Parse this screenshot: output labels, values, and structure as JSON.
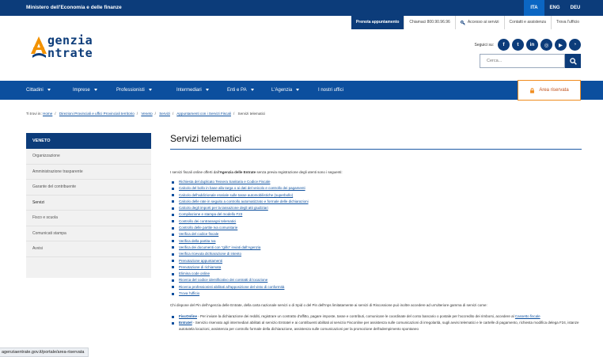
{
  "topbar": {
    "ministry": "Ministero dell'Economia e delle finanze",
    "languages": [
      "ITA",
      "ENG",
      "DEU"
    ],
    "active_language": "ITA"
  },
  "header": {
    "appointment_label": "Prenota appuntamento",
    "phone_label": "Chiamaci 800.90.96.96",
    "services_access_label": "Accesso ai servizi",
    "contacts_label": "Contatti e assistenza",
    "office_label": "Trova l'ufficio",
    "logo_line1": "genzia",
    "logo_line2": "ntrate",
    "social_label": "Seguici su:",
    "search_placeholder": "Cerca..."
  },
  "nav": {
    "items": [
      "Cittadini",
      "Imprese",
      "Professionisti",
      "Intermediari",
      "Enti e PA",
      "L'Agenzia",
      "I nostri uffici"
    ],
    "reserved_label": "Area riservata"
  },
  "breadcrumb": {
    "prefix": "Ti trovi in:",
    "items": [
      "Home",
      "Direzioni Provinciali e uffici Provinciali territorio",
      "Veneto",
      "Servizi",
      "Appuntamenti con i Servizi Fiscali",
      "Servizi telematici"
    ]
  },
  "sidebar": {
    "heading": "VENETO",
    "items": [
      "Organizzazione",
      "Amministrazione trasparente",
      "Garante del contribuente",
      "Servizi",
      "Fisco e scuola",
      "Comunicati stampa",
      "Avvisi"
    ]
  },
  "main": {
    "title": "Servizi telematici",
    "intro_before": "I servizi fiscali online offerti dall'",
    "intro_bold": "Agenzia delle Entrate",
    "intro_after": " senza previa registrazione degli utenti sono i seguenti:",
    "links": [
      "Richiesta del duplicato Tessera Sanitaria e Codice Fiscale",
      "Calcolo del bollo in base alla targa o ai dati del veicolo e controllo dei pagamenti",
      "Calcolo dell'addizionale erariale sulle tasse automobilistiche (superbollo)",
      "Calcolo delle rate in seguito a controllo automatizzato e formale delle dichiarazioni",
      "Calcolo degli importi per la tassazione degli atti giudiziari",
      "Compilazione e stampa del modello F23",
      "Controllo dei contrassegni telematici",
      "Controllo delle partite Iva comunitarie",
      "Verifica del codice fiscale",
      "Verifica della partita Iva",
      "Verifica dei documenti con \"glifo\" inviati dall'Agenzia",
      "Verifica ricevuta dichiarazione di intento",
      "Prenotazione appuntamenti",
      "Prenotazione di richiamata",
      "Elimina code online",
      "Ricerca del codice identificativo dei contratti di locazione",
      "Ricerca professionisti abilitati all'apposizione del visto di conformità",
      "Trova l'ufficio"
    ],
    "para": "Chi dispone del Pin dell'Agenzia delle Entrate, della carta nazionale servizi o di Spid o del Pin dell'Inps limitatamente ai servizi di Riscossione può inoltre accedere ad un'ulteriore gamma di servizi come:",
    "fisco_name": "FiscOnline",
    "fisco_text": " - Per inviare la dichiarazione dei redditi, registrare un contratto d'affitto, pagare imposte, tasse e contributi, comunicare le coordinate del conto bancario o postale per l'accredito dei rimborsi, accedere al ",
    "fisco_link": "Cassetto fiscale",
    "entratel_name": "Entratel",
    "entratel_text": " - Servizio riservato agli intermediari abilitati al servizio Entratel e ai contribuenti abilitati al servizio Fisconline per assistenza sulle comunicazioni di irregolarità, sugli avvisi telematici e le cartelle di pagamento, richiesta modifica delega F24, istanze autotutela locazioni, assistenza per controllo formale della dichiarazione, assistenza sulle comunicazioni per la promozione dell'adempimento spontaneo"
  },
  "status_url": "agenziaentrate.gov.it/portale/area-riservata"
}
